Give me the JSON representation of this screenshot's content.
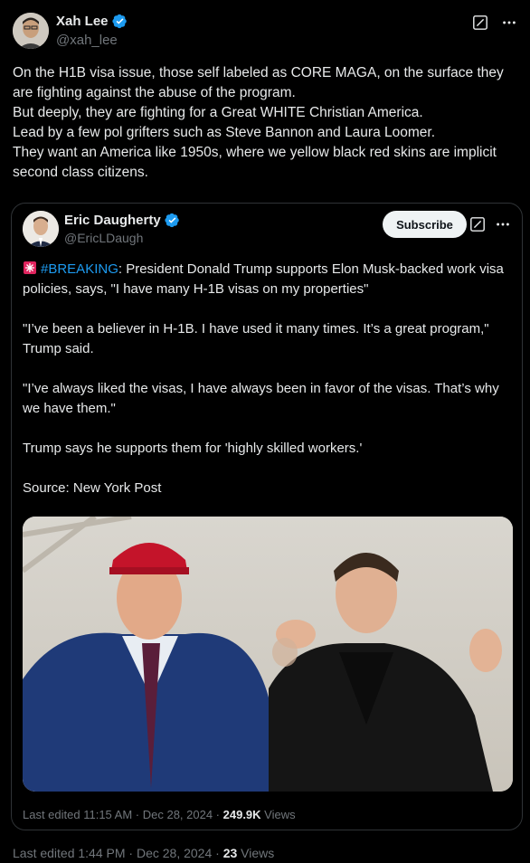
{
  "author": {
    "name": "Xah Lee",
    "handle": "@xah_lee"
  },
  "tweet": {
    "text": "On the H1B visa issue, those self labeled as CORE MAGA, on the surface they are fighting against the abuse of the program.\nBut deeply, they are fighting for a Great WHITE Christian America.\nLead by a few pol grifters such as Steve Bannon and Laura Loomer.\nThey want an America like 1950s, where we yellow black red skins are implicit second class citizens."
  },
  "quoted": {
    "name": "Eric Daugherty",
    "handle": "@EricLDaugh",
    "subscribe_label": "Subscribe",
    "hashtag": "#BREAKING",
    "line1_rest": ": President Donald Trump supports Elon Musk-backed work visa policies, says, \"I have many H-1B visas on my properties\"",
    "para2": "\"I’ve been a believer in H-1B. I have used it many times. It’s a great program,\" Trump said.",
    "para3": "\"I’ve always liked the visas, I have always been in favor of the visas. That’s why we have them.\"",
    "para4": "Trump says he supports them for 'highly skilled workers.'",
    "para5": "Source: New York Post",
    "footer_prefix": "Last edited 11:15 AM · Dec 28, 2024 · ",
    "views_count": "249.9K",
    "views_label": " Views"
  },
  "footer": {
    "prefix": "Last edited 1:44 PM · Dec 28, 2024 · ",
    "views_count": "23",
    "views_label": " Views"
  },
  "icons": {
    "verified": "verified-badge-icon",
    "edit": "edit-square-icon",
    "more": "more-dots-icon",
    "siren": "siren-emoji-icon"
  },
  "colors": {
    "background": "#000000",
    "text": "#e7e9ea",
    "muted": "#71767b",
    "accent": "#1d9bf0",
    "border": "#2f3336"
  }
}
